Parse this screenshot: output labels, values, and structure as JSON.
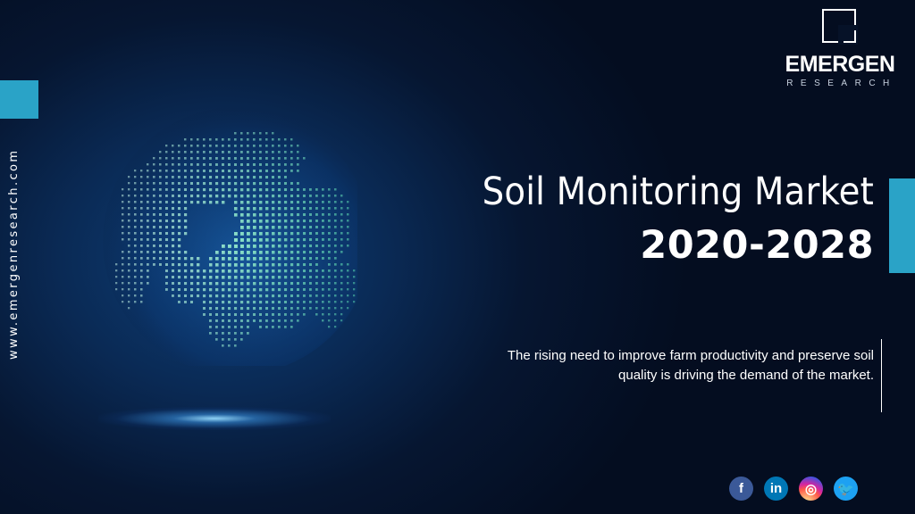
{
  "side_url": "www.emergenresearch.com",
  "logo": {
    "name": "EMERGEN",
    "sub": "RESEARCH"
  },
  "title": "Soil Monitoring Market",
  "years": "2020-2028",
  "description": {
    "line1": "The rising need to improve farm productivity and preserve soil",
    "line2": "quality is driving the demand of the market."
  },
  "social": [
    {
      "icon": "facebook-icon",
      "glyph": "f"
    },
    {
      "icon": "linkedin-icon",
      "glyph": "in"
    },
    {
      "icon": "instagram-icon",
      "glyph": "◎"
    },
    {
      "icon": "twitter-icon",
      "glyph": "🐦"
    }
  ],
  "colors": {
    "accent": "#2aa3c7",
    "background": "#061631"
  }
}
